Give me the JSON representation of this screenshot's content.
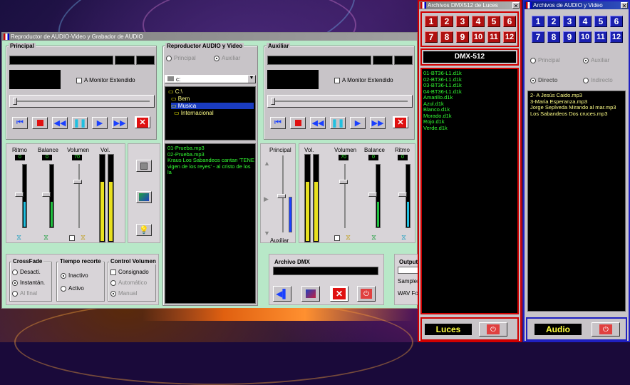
{
  "colors": {
    "accent_green": "#33ff33",
    "accent_yellow": "#ffff88",
    "red_panel": "#cc0000",
    "blue_panel": "#1a20b0"
  },
  "main": {
    "title": "Reproductor de AUDIO-Video y Grabador de AUDIO",
    "principal": {
      "label": "Principal",
      "monitor": "A Monitor Extendido"
    },
    "player": {
      "label": "Reproductor AUDIO y Video",
      "opt1": "Principal",
      "opt2": "Auxiliar",
      "drive": "c:",
      "tree": [
        "C:\\",
        "Bem",
        "Musica",
        "Internacional"
      ],
      "playlist": [
        "01-Prueba.mp3",
        "02-Prueba.mp3",
        "Kraus  Los Sabandeos cantan 'TENE",
        "vigen de los reyes' - al cristo de los la"
      ]
    },
    "auxiliar": {
      "label": "Auxiliar",
      "monitor": "A Monitor Extendido"
    },
    "mixer_left": {
      "ritmo": "Ritmo",
      "balance": "Balance",
      "volumen": "Volumen",
      "vol": "Vol.",
      "ritmo_val": "0",
      "balance_val": "0",
      "vol_val": "70"
    },
    "mixer_right": {
      "principal": "Principal",
      "auxiliar": "Auxiliar",
      "vol": "Vol.",
      "volumen": "Volumen",
      "balance": "Balance",
      "ritmo": "Ritmo",
      "vol_val": "70",
      "balance_val": "0",
      "ritmo_val": "0"
    },
    "crossfade": {
      "label": "CrossFade",
      "opts": [
        "Desacti.",
        "Instantán.",
        "Al final"
      ]
    },
    "tiempo": {
      "label": "Tiempo recorte",
      "opts": [
        "Inactivo",
        "Activo"
      ]
    },
    "control": {
      "label": "Control Volumen",
      "opts": [
        "Consignado",
        "Automático",
        "Manual"
      ]
    },
    "dmx": {
      "label": "Archivo DMX"
    },
    "output": {
      "label": "Output",
      "sampler": "Sampler",
      "wav": "WAV Fo"
    }
  },
  "dmx_window": {
    "title": "Archivos DMX512 de Luces",
    "buttons": [
      "1",
      "2",
      "3",
      "4",
      "5",
      "6",
      "7",
      "8",
      "9",
      "10",
      "11",
      "12"
    ],
    "banner": "DMX-512",
    "files": [
      "01-BT36-L1.d1k",
      "02-BT36-L1.d1k",
      "03-BT36-L1.d1k",
      "04-BT36-L1.d1k",
      "Amarillo.d1k",
      "Azul.d1k",
      "Blanco.d1k",
      "Morado.d1k",
      "Rojo.d1k",
      "Verde.d1k"
    ],
    "footer": "Luces"
  },
  "audio_window": {
    "title": "Archivos de AUDIO y Video",
    "buttons": [
      "1",
      "2",
      "3",
      "4",
      "5",
      "6",
      "7",
      "8",
      "9",
      "10",
      "11",
      "12"
    ],
    "opt_principal": "Principal",
    "opt_auxiliar": "Auxiliar",
    "opt_directo": "Directo",
    "opt_indirecto": "Indirecto",
    "files": [
      "2- A Jesús Caido.mp3",
      "3-Maria Esperanza.mp3",
      "Jorge Seplveda   Mirando al mar.mp3",
      "Los Sabandeos   Dos cruces.mp3"
    ],
    "footer": "Audio"
  }
}
